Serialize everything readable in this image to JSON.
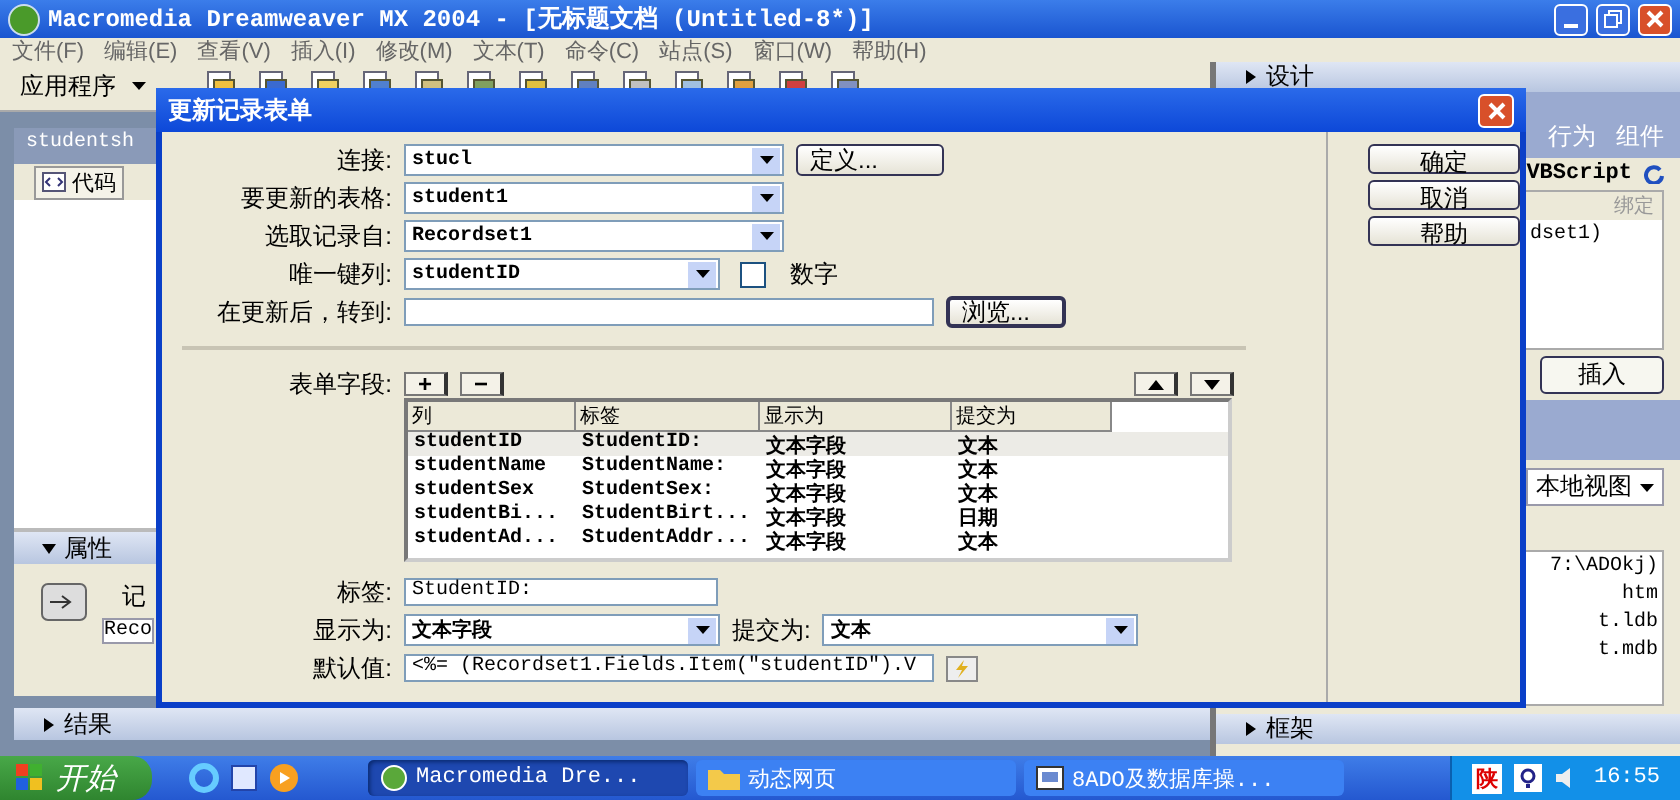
{
  "window": {
    "title": "Macromedia Dreamweaver MX 2004 - [无标题文档 (Untitled-8*)]"
  },
  "menu": [
    "文件(F)",
    "编辑(E)",
    "查看(V)",
    "插入(I)",
    "修改(M)",
    "文本(T)",
    "命令(C)",
    "站点(S)",
    "窗口(W)",
    "帮助(H)"
  ],
  "toolbar": {
    "category": "应用程序"
  },
  "document": {
    "tab": "studentsh",
    "code_button": "代码"
  },
  "properties": {
    "title": "属性",
    "name_label": "记",
    "name_value": "Reco"
  },
  "results": {
    "title": "结果"
  },
  "right_panel": {
    "design_title": "设计",
    "tabs": [
      "行为",
      "组件"
    ],
    "language": "VBScript",
    "bindings_header": "绑定",
    "binding_item": "dset1)",
    "insert_button": "插入",
    "view_select": "本地视图",
    "site_path": "7:\\ADOkj)",
    "files": [
      "htm",
      "t.ldb",
      "t.mdb"
    ],
    "frames_title": "框架"
  },
  "dialog": {
    "title": "更新记录表单",
    "connection": {
      "label": "连接:",
      "value": "stucl",
      "button": "定义..."
    },
    "table": {
      "label": "要更新的表格:",
      "value": "student1"
    },
    "recordset": {
      "label": "选取记录自:",
      "value": "Recordset1"
    },
    "key_column": {
      "label": "唯一键列:",
      "value": "studentID",
      "numeric_label": "数字",
      "numeric_checked": false
    },
    "after_update": {
      "label": "在更新后，转到:",
      "button": "浏览..."
    },
    "form_fields": {
      "label": "表单字段:",
      "add": "+",
      "remove": "−",
      "columns": [
        "列",
        "标签",
        "显示为",
        "提交为"
      ],
      "rows": [
        {
          "cells": [
            "studentID",
            "StudentID:",
            "文本字段",
            "文本"
          ],
          "selected": true
        },
        {
          "cells": [
            "studentName",
            "StudentName:",
            "文本字段",
            "文本"
          ],
          "selected": false
        },
        {
          "cells": [
            "studentSex",
            "StudentSex:",
            "文本字段",
            "文本"
          ],
          "selected": false
        },
        {
          "cells": [
            "studentBi...",
            "StudentBirt...",
            "文本字段",
            "日期"
          ],
          "selected": false
        },
        {
          "cells": [
            "studentAd...",
            "StudentAddr...",
            "文本字段",
            "文本"
          ],
          "selected": false
        }
      ]
    },
    "label_field": {
      "label": "标签:",
      "value": "StudentID:"
    },
    "display_as": {
      "label": "显示为:",
      "value": "文本字段"
    },
    "submit_as": {
      "label": "提交为:",
      "value": "文本"
    },
    "default_value": {
      "label": "默认值:",
      "value": "<%= (Recordset1.Fields.Item(\"studentID\").V"
    },
    "buttons": [
      "确定",
      "取消",
      "帮助"
    ]
  },
  "taskbar": {
    "start": "开始",
    "tasks": [
      {
        "label": "Macromedia Dre...",
        "kind": "app",
        "selected": true
      },
      {
        "label": "动态网页",
        "kind": "folder",
        "selected": false
      },
      {
        "label": "8ADO及数据库操...",
        "kind": "doc",
        "selected": false
      }
    ],
    "ime": "陕",
    "clock": "16:55"
  }
}
